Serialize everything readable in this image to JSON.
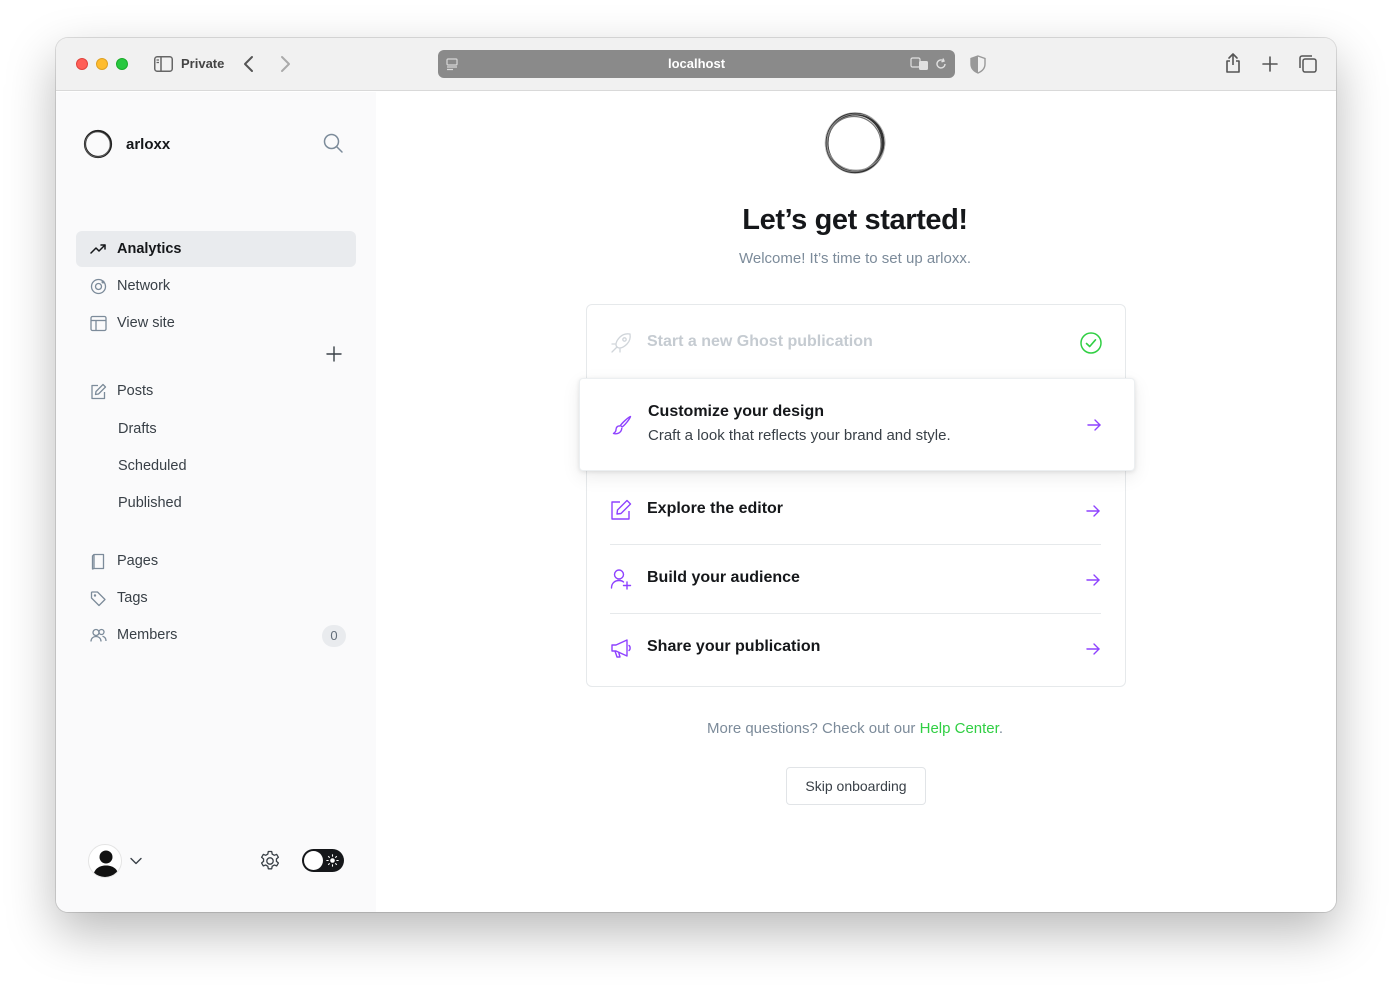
{
  "browser": {
    "mode_label": "Private",
    "url": "localhost"
  },
  "sidebar": {
    "site_name": "arloxx",
    "nav": [
      {
        "label": "Analytics",
        "icon": "analytics-icon",
        "active": true
      },
      {
        "label": "Network",
        "icon": "network-icon"
      },
      {
        "label": "View site",
        "icon": "view-site-icon"
      }
    ],
    "posts": {
      "label": "Posts",
      "subitems": [
        "Drafts",
        "Scheduled",
        "Published"
      ]
    },
    "content_nav": [
      {
        "label": "Pages",
        "icon": "pages-icon"
      },
      {
        "label": "Tags",
        "icon": "tags-icon"
      },
      {
        "label": "Members",
        "icon": "members-icon",
        "count": "0"
      }
    ],
    "theme": "light"
  },
  "onboarding": {
    "title": "Let’s get started!",
    "subtitle": "Welcome! It’s time to set up arloxx.",
    "steps": [
      {
        "title": "Start a new Ghost publication",
        "icon": "rocket-icon",
        "status": "done"
      },
      {
        "title": "Customize your design",
        "description": "Craft a look that reflects your brand and style.",
        "icon": "brush-icon",
        "status": "active"
      },
      {
        "title": "Explore the editor",
        "icon": "edit-icon",
        "status": "pending"
      },
      {
        "title": "Build your audience",
        "icon": "add-member-icon",
        "status": "pending"
      },
      {
        "title": "Share your publication",
        "icon": "megaphone-icon",
        "status": "pending"
      }
    ],
    "help_prefix": "More questions? Check out our ",
    "help_link": "Help Center",
    "help_suffix": ".",
    "skip_label": "Skip onboarding"
  },
  "colors": {
    "accent_purple": "#8e42ff",
    "green": "#30cf43",
    "text_dark": "#15171a"
  }
}
